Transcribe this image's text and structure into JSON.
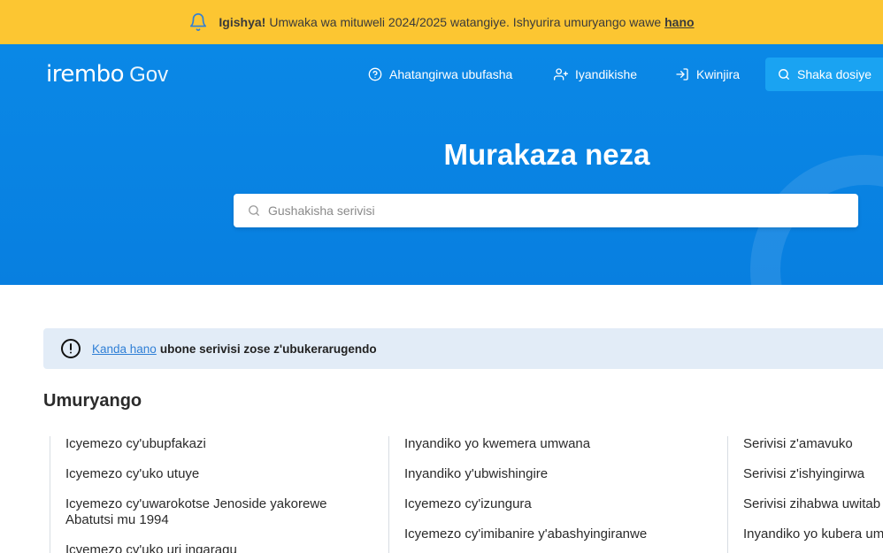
{
  "announcement": {
    "title": "Igishya!",
    "message": "Umwaka wa mituweli 2024/2025 watangiye. Ishyurira umuryango wawe",
    "link": "hano"
  },
  "header": {
    "brand": "irembo",
    "brand_suffix": "Gov",
    "nav": {
      "help": "Ahatangirwa ubufasha",
      "register": "Iyandikishe",
      "login": "Kwinjira",
      "search_application": "Shaka dosiye"
    }
  },
  "hero": {
    "title": "Murakaza neza",
    "search_placeholder": "Gushakisha serivisi"
  },
  "info_banner": {
    "link": "Kanda hano",
    "text": "ubone serivisi zose z'ubukerarugendo"
  },
  "section": {
    "title": "Umuryango",
    "columns": [
      [
        "Icyemezo cy'ubupfakazi",
        "Icyemezo cy'uko utuye",
        "Icyemezo cy'uwarokotse Jenoside yakorewe Abatutsi mu 1994",
        "Icyemezo cy'uko uri ingaragu"
      ],
      [
        "Inyandiko yo kwemera umwana",
        "Inyandiko y'ubwishingire",
        "Icyemezo cy'izungura",
        "Icyemezo cy'imibanire y'abashyingiranwe"
      ],
      [
        "Serivisi z'amavuko",
        "Serivisi z'ishyingirwa",
        "Serivisi zihabwa uwitab",
        "Inyandiko yo kubera um"
      ]
    ]
  },
  "colors": {
    "announcement_bg": "#fcc632",
    "hero_bg": "#0a88e6",
    "nav_search_bg": "#1aa3f2",
    "info_bg": "#e2ecf7",
    "link": "#2f7fd6"
  }
}
